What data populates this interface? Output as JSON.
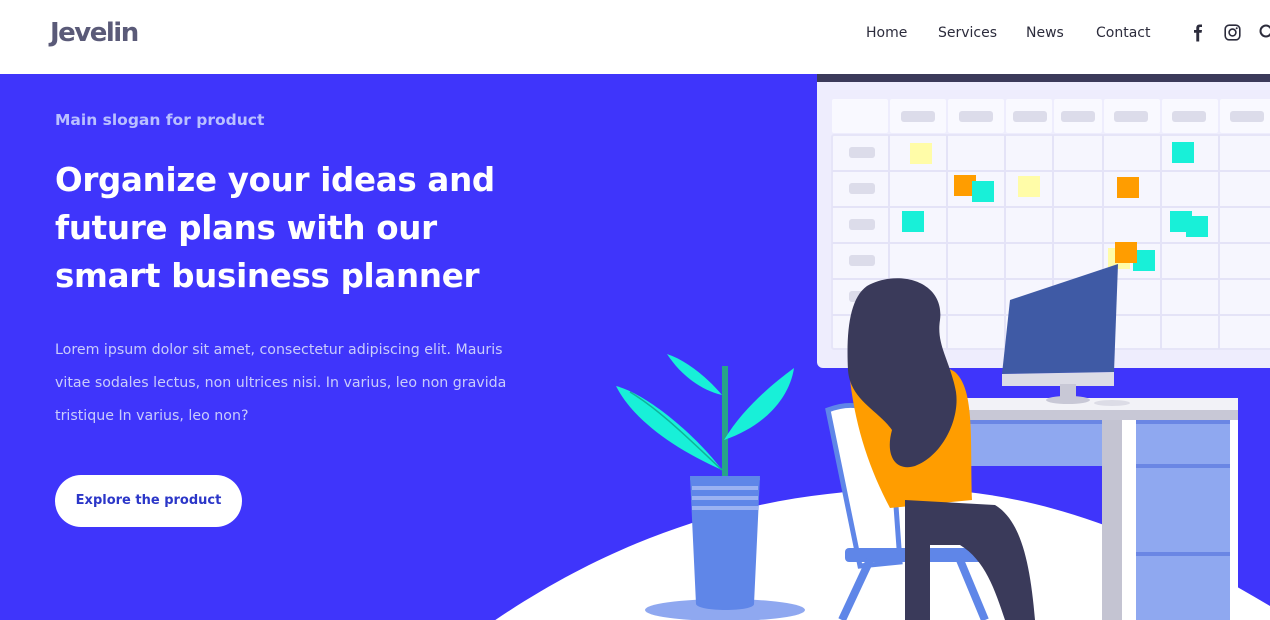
{
  "brand": {
    "name": "Jevelin"
  },
  "nav": {
    "items": [
      "Home",
      "Services",
      "News",
      "Contact"
    ]
  },
  "social": {
    "icons": [
      "facebook-icon",
      "instagram-icon",
      "search-icon"
    ]
  },
  "hero": {
    "slogan": "Main slogan for product",
    "headline": "Organize your ideas and future plans with our smart business planner",
    "body": "Lorem ipsum dolor sit amet, consectetur adipiscing elit. Mauris vitae sodales lectus, non ultrices nisi. In varius, leo non gravida tristique In varius, leo non?",
    "cta_label": "Explore the product"
  },
  "colors": {
    "hero_background": "#3f35fb",
    "cta_text": "#2b36c8",
    "accent_orange": "#ff9d00",
    "accent_teal": "#18f0d8"
  }
}
